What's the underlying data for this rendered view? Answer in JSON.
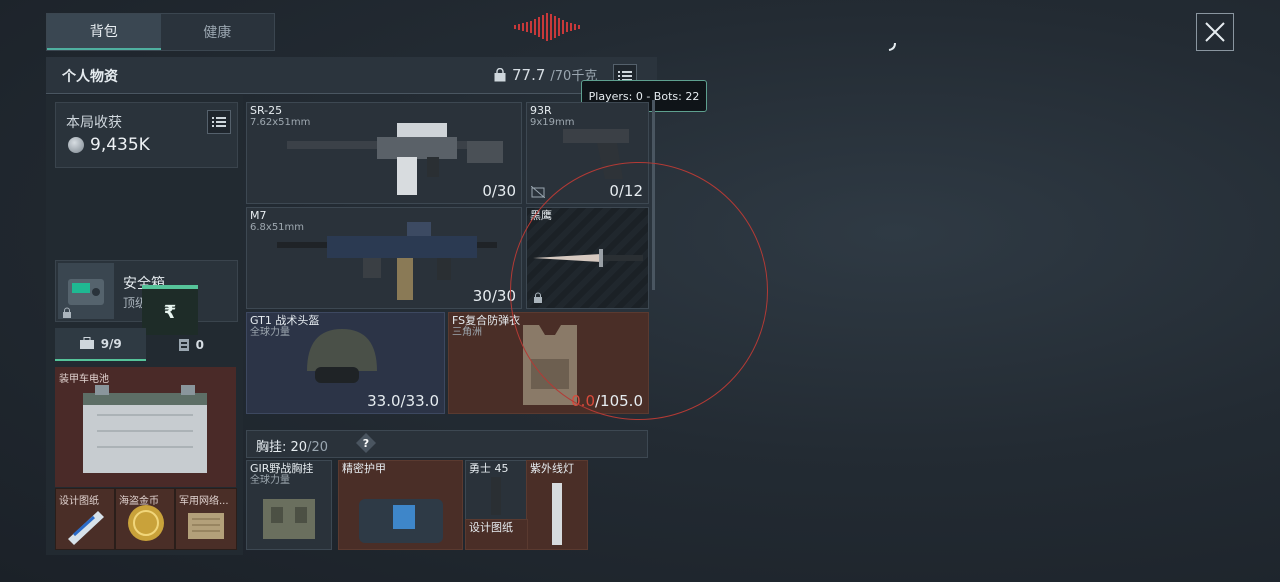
{
  "tabs": [
    {
      "label": "背包"
    },
    {
      "label": "健康"
    }
  ],
  "header": {
    "title": "个人物资",
    "weight": "77.7",
    "weight_cap": "/70千克"
  },
  "tooltip": "Players: 0 - Bots: 22",
  "harvest": {
    "label": "本局收获",
    "value": "9,435K"
  },
  "safe_box": {
    "name": "安全箱",
    "sub": "顶级"
  },
  "rupee_symbol": "₹",
  "counts": {
    "bag": "9/9",
    "vest": "0"
  },
  "battery": {
    "label": "装甲车电池"
  },
  "loot_items": [
    {
      "label": "设计图纸"
    },
    {
      "label": "海盗金币"
    },
    {
      "label": "军用网络..."
    }
  ],
  "weapons": [
    {
      "name": "SR-25",
      "caliber": "7.62x51mm",
      "ammo": "0/30"
    },
    {
      "name": "93R",
      "caliber": "9x19mm",
      "ammo": "0/12"
    },
    {
      "name": "M7",
      "caliber": "6.8x51mm",
      "ammo": "30/30"
    },
    {
      "name": "黑鹰",
      "caliber": "",
      "ammo": ""
    }
  ],
  "helmet": {
    "name": "GT1 战术头盔",
    "sub": "全球力量",
    "durability": "33.0/33.0"
  },
  "armor": {
    "name": "FS复合防弹衣",
    "sub": "三角洲",
    "durability_current": "0.0",
    "durability_max": "/105.0"
  },
  "chest_rig": {
    "label": "胸挂:",
    "value": "20",
    "cap": "/20",
    "help": "?"
  },
  "rig_items": [
    {
      "name": "GIR野战胸挂",
      "sub": "全球力量"
    },
    {
      "name": "精密护甲",
      "sub": ""
    },
    {
      "name": "勇士 45",
      "sub": ""
    },
    {
      "name": "紫外线灯",
      "sub": ""
    },
    {
      "name": "设计图纸",
      "sub": ""
    }
  ],
  "colors": {
    "accent": "#56c49a",
    "damage": "#d94b3c",
    "tooltip_border": "#5ea08f",
    "ring": "#b33a35",
    "audio": "#c8393a"
  }
}
